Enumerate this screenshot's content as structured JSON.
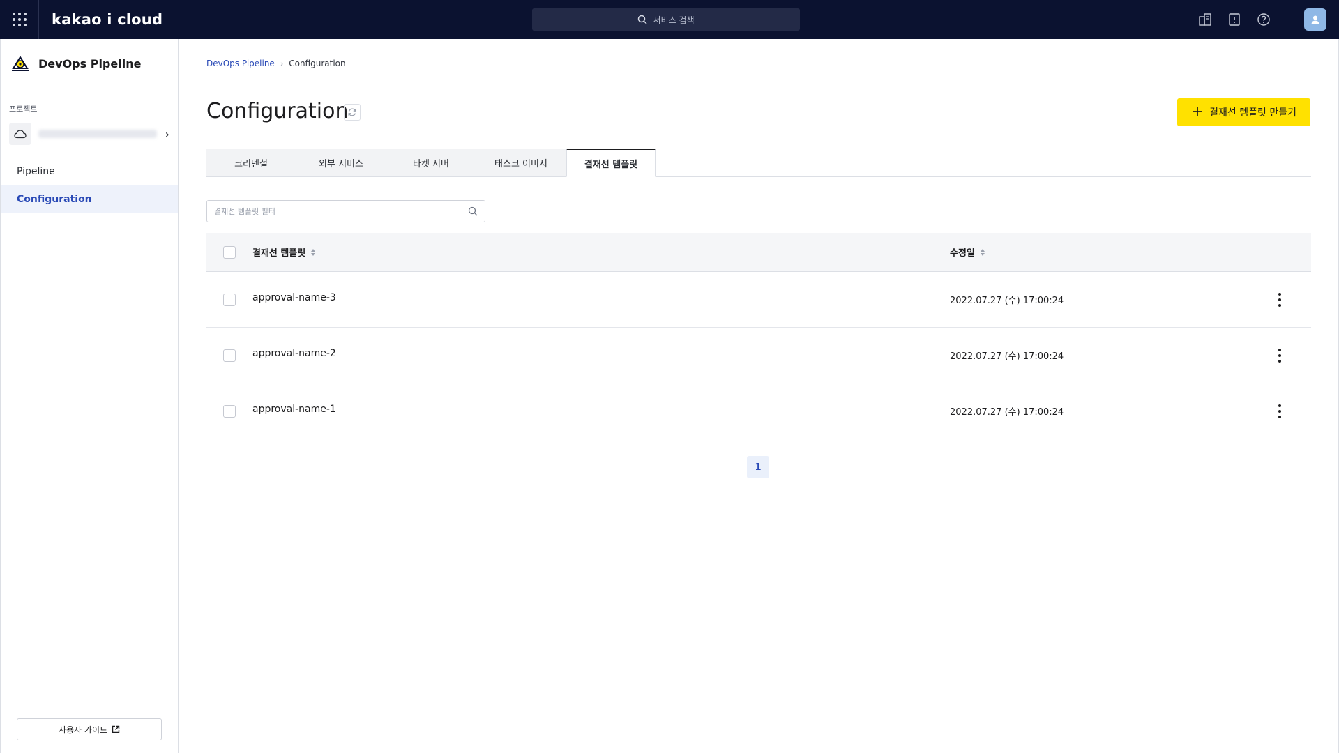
{
  "topbar": {
    "brand": "kakao i cloud",
    "search_placeholder": "서비스 검색",
    "icons": [
      "organization-icon",
      "notice-icon",
      "help-icon",
      "user-avatar-icon"
    ]
  },
  "sidebar": {
    "title": "DevOps Pipeline",
    "section_label": "프로젝트",
    "nav": [
      {
        "label": "Pipeline",
        "active": false
      },
      {
        "label": "Configuration",
        "active": true
      }
    ],
    "guide_label": "사용자 가이드"
  },
  "breadcrumb": {
    "parent": "DevOps Pipeline",
    "current": "Configuration"
  },
  "page": {
    "title": "Configuration",
    "create_button": "결재선 템플릿 만들기"
  },
  "tabs": [
    {
      "label": "크리덴셜",
      "active": false
    },
    {
      "label": "외부 서비스",
      "active": false
    },
    {
      "label": "타켓 서버",
      "active": false
    },
    {
      "label": "태스크 이미지",
      "active": false
    },
    {
      "label": "결재선 템플릿",
      "active": true
    }
  ],
  "filter": {
    "placeholder": "결재선 템플릿 필터"
  },
  "table": {
    "columns": [
      "결재선 템플릿",
      "수정일"
    ],
    "rows": [
      {
        "name": "approval-name-3",
        "modified": "2022.07.27 (수) 17:00:24"
      },
      {
        "name": "approval-name-2",
        "modified": "2022.07.27 (수) 17:00:24"
      },
      {
        "name": "approval-name-1",
        "modified": "2022.07.27 (수) 17:00:24"
      }
    ]
  },
  "pagination": {
    "current_page": "1"
  },
  "colors": {
    "topbar_bg": "#0b1230",
    "accent": "#ffe100",
    "link": "#2949b6"
  }
}
